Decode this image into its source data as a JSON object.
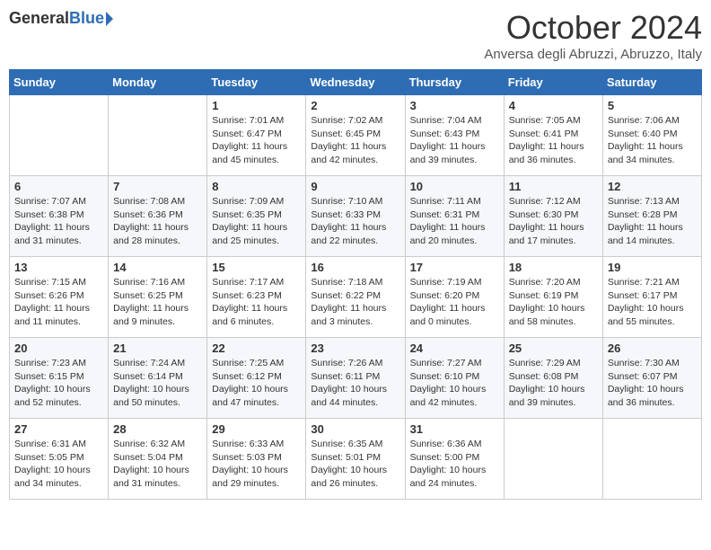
{
  "logo": {
    "general": "General",
    "blue": "Blue"
  },
  "title": "October 2024",
  "location": "Anversa degli Abruzzi, Abruzzo, Italy",
  "days_of_week": [
    "Sunday",
    "Monday",
    "Tuesday",
    "Wednesday",
    "Thursday",
    "Friday",
    "Saturday"
  ],
  "weeks": [
    [
      {
        "day": "",
        "sunrise": "",
        "sunset": "",
        "daylight": ""
      },
      {
        "day": "",
        "sunrise": "",
        "sunset": "",
        "daylight": ""
      },
      {
        "day": "1",
        "sunrise": "Sunrise: 7:01 AM",
        "sunset": "Sunset: 6:47 PM",
        "daylight": "Daylight: 11 hours and 45 minutes."
      },
      {
        "day": "2",
        "sunrise": "Sunrise: 7:02 AM",
        "sunset": "Sunset: 6:45 PM",
        "daylight": "Daylight: 11 hours and 42 minutes."
      },
      {
        "day": "3",
        "sunrise": "Sunrise: 7:04 AM",
        "sunset": "Sunset: 6:43 PM",
        "daylight": "Daylight: 11 hours and 39 minutes."
      },
      {
        "day": "4",
        "sunrise": "Sunrise: 7:05 AM",
        "sunset": "Sunset: 6:41 PM",
        "daylight": "Daylight: 11 hours and 36 minutes."
      },
      {
        "day": "5",
        "sunrise": "Sunrise: 7:06 AM",
        "sunset": "Sunset: 6:40 PM",
        "daylight": "Daylight: 11 hours and 34 minutes."
      }
    ],
    [
      {
        "day": "6",
        "sunrise": "Sunrise: 7:07 AM",
        "sunset": "Sunset: 6:38 PM",
        "daylight": "Daylight: 11 hours and 31 minutes."
      },
      {
        "day": "7",
        "sunrise": "Sunrise: 7:08 AM",
        "sunset": "Sunset: 6:36 PM",
        "daylight": "Daylight: 11 hours and 28 minutes."
      },
      {
        "day": "8",
        "sunrise": "Sunrise: 7:09 AM",
        "sunset": "Sunset: 6:35 PM",
        "daylight": "Daylight: 11 hours and 25 minutes."
      },
      {
        "day": "9",
        "sunrise": "Sunrise: 7:10 AM",
        "sunset": "Sunset: 6:33 PM",
        "daylight": "Daylight: 11 hours and 22 minutes."
      },
      {
        "day": "10",
        "sunrise": "Sunrise: 7:11 AM",
        "sunset": "Sunset: 6:31 PM",
        "daylight": "Daylight: 11 hours and 20 minutes."
      },
      {
        "day": "11",
        "sunrise": "Sunrise: 7:12 AM",
        "sunset": "Sunset: 6:30 PM",
        "daylight": "Daylight: 11 hours and 17 minutes."
      },
      {
        "day": "12",
        "sunrise": "Sunrise: 7:13 AM",
        "sunset": "Sunset: 6:28 PM",
        "daylight": "Daylight: 11 hours and 14 minutes."
      }
    ],
    [
      {
        "day": "13",
        "sunrise": "Sunrise: 7:15 AM",
        "sunset": "Sunset: 6:26 PM",
        "daylight": "Daylight: 11 hours and 11 minutes."
      },
      {
        "day": "14",
        "sunrise": "Sunrise: 7:16 AM",
        "sunset": "Sunset: 6:25 PM",
        "daylight": "Daylight: 11 hours and 9 minutes."
      },
      {
        "day": "15",
        "sunrise": "Sunrise: 7:17 AM",
        "sunset": "Sunset: 6:23 PM",
        "daylight": "Daylight: 11 hours and 6 minutes."
      },
      {
        "day": "16",
        "sunrise": "Sunrise: 7:18 AM",
        "sunset": "Sunset: 6:22 PM",
        "daylight": "Daylight: 11 hours and 3 minutes."
      },
      {
        "day": "17",
        "sunrise": "Sunrise: 7:19 AM",
        "sunset": "Sunset: 6:20 PM",
        "daylight": "Daylight: 11 hours and 0 minutes."
      },
      {
        "day": "18",
        "sunrise": "Sunrise: 7:20 AM",
        "sunset": "Sunset: 6:19 PM",
        "daylight": "Daylight: 10 hours and 58 minutes."
      },
      {
        "day": "19",
        "sunrise": "Sunrise: 7:21 AM",
        "sunset": "Sunset: 6:17 PM",
        "daylight": "Daylight: 10 hours and 55 minutes."
      }
    ],
    [
      {
        "day": "20",
        "sunrise": "Sunrise: 7:23 AM",
        "sunset": "Sunset: 6:15 PM",
        "daylight": "Daylight: 10 hours and 52 minutes."
      },
      {
        "day": "21",
        "sunrise": "Sunrise: 7:24 AM",
        "sunset": "Sunset: 6:14 PM",
        "daylight": "Daylight: 10 hours and 50 minutes."
      },
      {
        "day": "22",
        "sunrise": "Sunrise: 7:25 AM",
        "sunset": "Sunset: 6:12 PM",
        "daylight": "Daylight: 10 hours and 47 minutes."
      },
      {
        "day": "23",
        "sunrise": "Sunrise: 7:26 AM",
        "sunset": "Sunset: 6:11 PM",
        "daylight": "Daylight: 10 hours and 44 minutes."
      },
      {
        "day": "24",
        "sunrise": "Sunrise: 7:27 AM",
        "sunset": "Sunset: 6:10 PM",
        "daylight": "Daylight: 10 hours and 42 minutes."
      },
      {
        "day": "25",
        "sunrise": "Sunrise: 7:29 AM",
        "sunset": "Sunset: 6:08 PM",
        "daylight": "Daylight: 10 hours and 39 minutes."
      },
      {
        "day": "26",
        "sunrise": "Sunrise: 7:30 AM",
        "sunset": "Sunset: 6:07 PM",
        "daylight": "Daylight: 10 hours and 36 minutes."
      }
    ],
    [
      {
        "day": "27",
        "sunrise": "Sunrise: 6:31 AM",
        "sunset": "Sunset: 5:05 PM",
        "daylight": "Daylight: 10 hours and 34 minutes."
      },
      {
        "day": "28",
        "sunrise": "Sunrise: 6:32 AM",
        "sunset": "Sunset: 5:04 PM",
        "daylight": "Daylight: 10 hours and 31 minutes."
      },
      {
        "day": "29",
        "sunrise": "Sunrise: 6:33 AM",
        "sunset": "Sunset: 5:03 PM",
        "daylight": "Daylight: 10 hours and 29 minutes."
      },
      {
        "day": "30",
        "sunrise": "Sunrise: 6:35 AM",
        "sunset": "Sunset: 5:01 PM",
        "daylight": "Daylight: 10 hours and 26 minutes."
      },
      {
        "day": "31",
        "sunrise": "Sunrise: 6:36 AM",
        "sunset": "Sunset: 5:00 PM",
        "daylight": "Daylight: 10 hours and 24 minutes."
      },
      {
        "day": "",
        "sunrise": "",
        "sunset": "",
        "daylight": ""
      },
      {
        "day": "",
        "sunrise": "",
        "sunset": "",
        "daylight": ""
      }
    ]
  ]
}
